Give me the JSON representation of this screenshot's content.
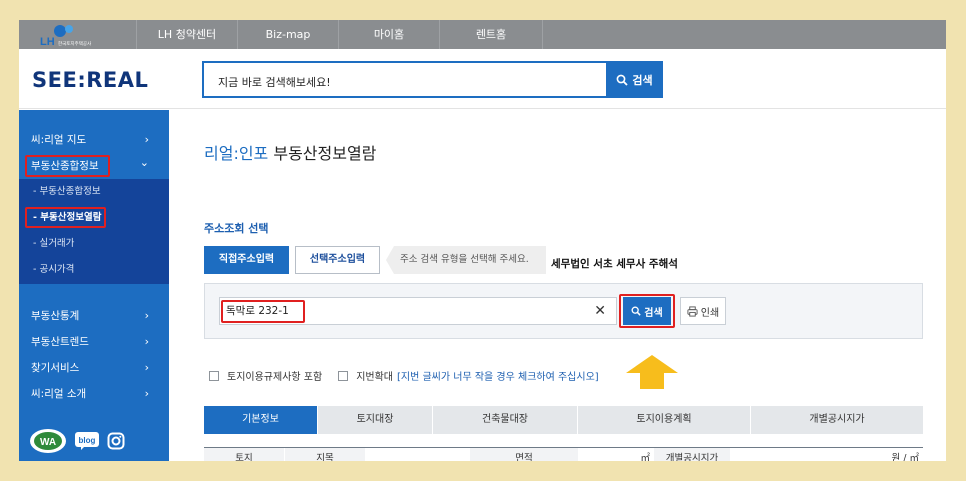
{
  "topnav": {
    "logo_text": "LH",
    "logo_subtext": "한국토지주택공사",
    "items": [
      "LH 청약센터",
      "Biz-map",
      "마이홈",
      "렌트홈"
    ]
  },
  "header": {
    "brand": "SEE:REAL",
    "search_placeholder": "지금 바로 검색해보세요!",
    "search_button": "검색"
  },
  "sidebar": {
    "items": [
      {
        "label": "씨:리얼 지도",
        "chevron": "›"
      },
      {
        "label": "부동산종합정보",
        "chevron": "⌄"
      },
      {
        "label": "부동산통계",
        "chevron": "›"
      },
      {
        "label": "부동산트렌드",
        "chevron": "›"
      },
      {
        "label": "찾기서비스",
        "chevron": "›"
      },
      {
        "label": "씨:리얼 소개",
        "chevron": "›"
      }
    ],
    "subitems": [
      "- 부동산종합정보",
      "- 부동산정보열람",
      "- 실거래가",
      "- 공시가격"
    ],
    "badges": [
      "WA",
      "blog",
      "instagram-icon"
    ]
  },
  "content": {
    "title_highlight": "리얼:인포",
    "title_rest": " 부동산정보열람",
    "section_title": "주소조회 선택",
    "tab_direct": "직접주소입력",
    "tab_select": "선택주소입력",
    "tab_hint": "주소 검색 유형을 선택해 주세요.",
    "watermark": "세무법인 서초 세무사 주해석",
    "address_value": "독막로 232-1",
    "clear_icon": "✕",
    "search_button": "검색",
    "print_button": "인쇄",
    "option1": "토지이용규제사항 포함",
    "option2": "지번확대",
    "option2_note": "[지번 글씨가 너무 작을 경우 체크하여 주십시오]",
    "info_tabs": [
      "기본정보",
      "토지대장",
      "건축물대장",
      "토지이용계획",
      "개별공시지가"
    ],
    "table_headers": [
      "토지",
      "지목",
      "면적",
      "㎡",
      "개별공시지가",
      "원 / ㎡"
    ]
  },
  "colors": {
    "accent": "#1d6dc1",
    "highlight_box": "#e02020",
    "arrow": "#f7bd1c",
    "background": "#f1e3b0"
  }
}
